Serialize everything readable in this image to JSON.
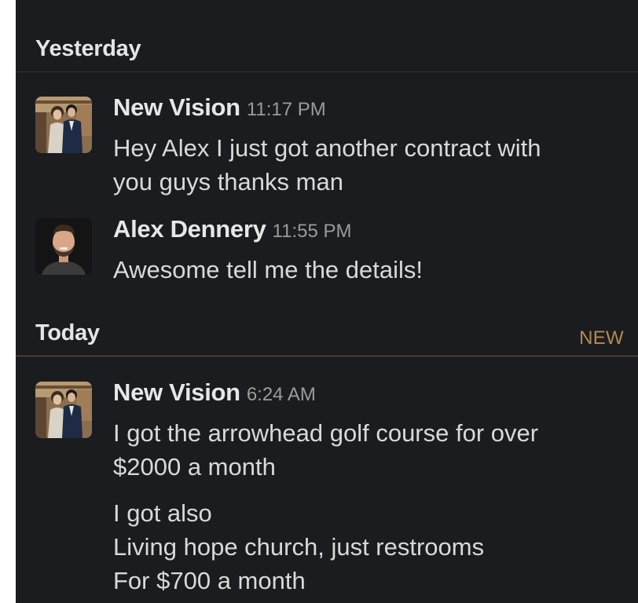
{
  "channel": {
    "sections": [
      {
        "day": "Yesterday",
        "messages": [
          {
            "sender": "New Vision",
            "time": "11:17 PM",
            "avatar": "couple-photo-avatar",
            "lines": [
              "Hey Alex I just got another contract with",
              "you guys thanks man"
            ]
          },
          {
            "sender": "Alex Dennery",
            "time": "11:55 PM",
            "avatar": "man-portrait-avatar",
            "lines": [
              "Awesome tell me the details!"
            ]
          }
        ]
      },
      {
        "day": "Today",
        "new_badge": "NEW",
        "messages": [
          {
            "sender": "New Vision",
            "time": "6:24 AM",
            "avatar": "couple-photo-avatar",
            "lines": [
              "I got the arrowhead golf course for over",
              "$2000  a month"
            ],
            "lines_2": [
              "I got also",
              "Living hope church, just restrooms",
              "For $700 a month"
            ]
          }
        ]
      }
    ]
  },
  "colors": {
    "background": "#1b1c1f",
    "text": "#d8d9da",
    "timestamp": "#9a9b9d",
    "new_accent": "#b48a4f",
    "divider": "#313236"
  }
}
